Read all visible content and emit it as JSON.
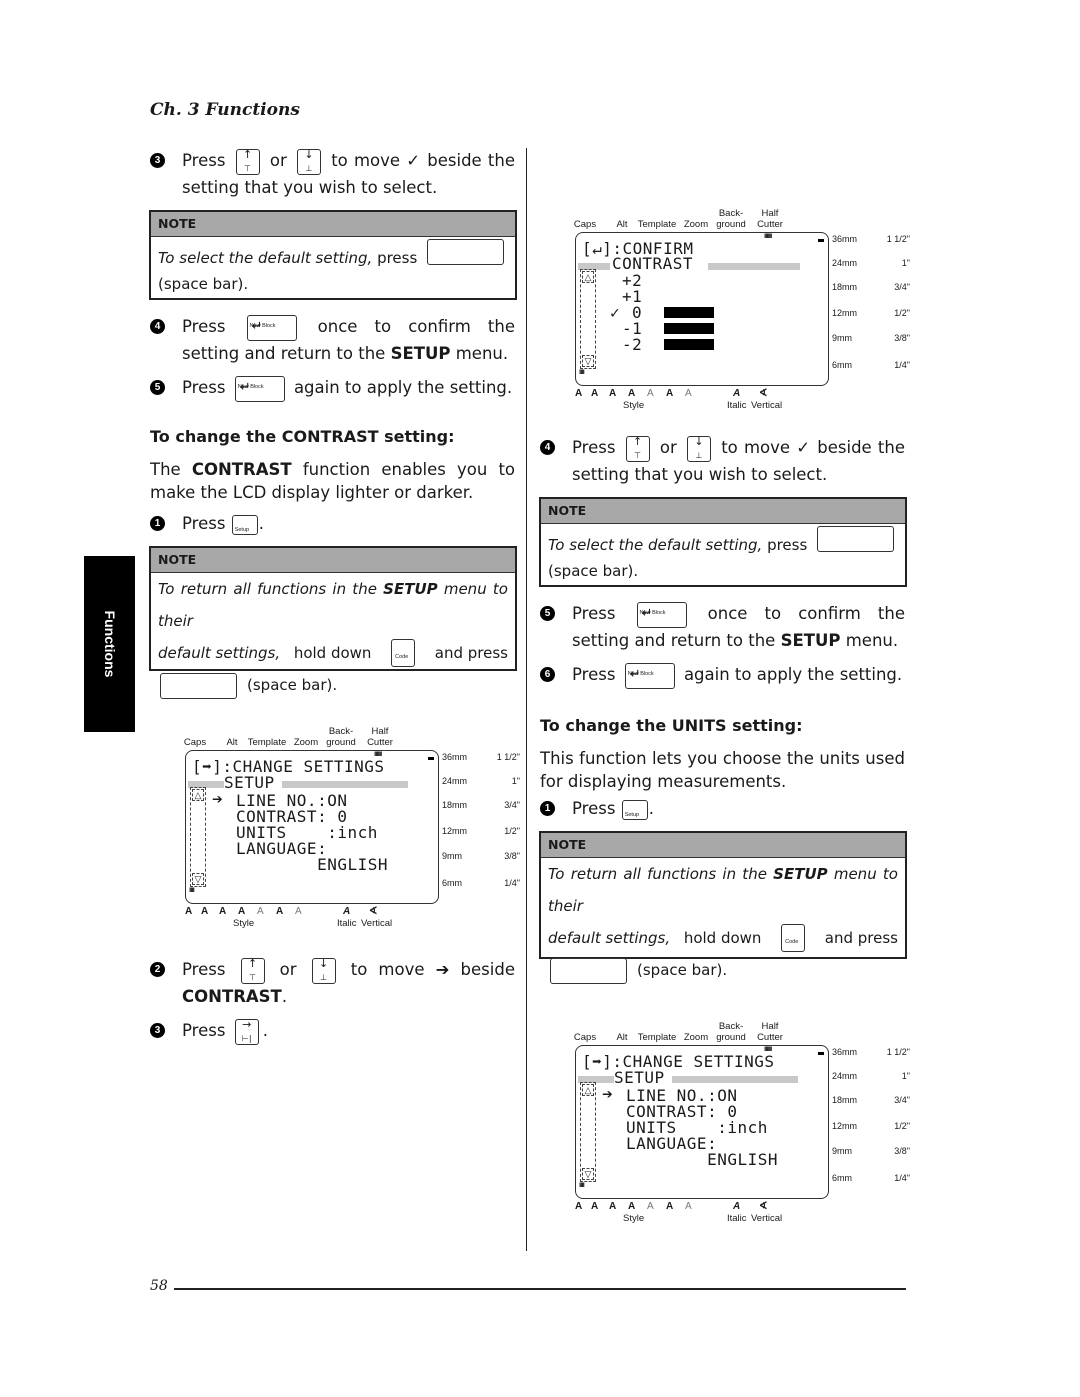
{
  "chapter_title": "Ch. 3 Functions",
  "side_tab": "Functions",
  "page_number": "58",
  "keys": {
    "up_glyph": "↑",
    "down_glyph": "↓",
    "up_sub": "⊤",
    "down_sub": "⊥",
    "right_glyph": "→",
    "right_sub": "⊢|",
    "new_block_glyph": "↵",
    "new_block_label": "New Block",
    "setup_label": "Setup",
    "code_label": "Code"
  },
  "left": {
    "step3": {
      "num": "3",
      "pre": "Press",
      "or": "or",
      "post": "to move ✓ beside the setting that you wish to select."
    },
    "note1": {
      "header": "NOTE",
      "italic": "To select the default setting,",
      "press": "press",
      "tail": "(space bar)."
    },
    "step4": {
      "num": "4",
      "pre": "Press",
      "post": "once to confirm the setting and return to the",
      "kw": "SETUP",
      "end": "menu."
    },
    "step5": {
      "num": "5",
      "pre": "Press",
      "post": "again to apply the setting."
    },
    "contrast_heading": "To change the CONTRAST setting:",
    "contrast_para": {
      "pre": "The",
      "kw": "CONTRAST",
      "post": "function enables you to make the LCD display lighter or darker."
    },
    "c_step1": {
      "num": "1",
      "pre": "Press",
      "end": "."
    },
    "note2": {
      "header": "NOTE",
      "i1": "To return all functions in the",
      "kw": "SETUP",
      "i2": "menu to their",
      "i3": "default settings,",
      "hold": "hold down",
      "and": "and press",
      "tail": "(space bar)."
    },
    "c_step2": {
      "num": "2",
      "pre": "Press",
      "or": "or",
      "post": "to move ➔ beside",
      "kw": "CONTRAST",
      "end": "."
    },
    "c_step3": {
      "num": "3",
      "pre": "Press",
      "end": "."
    }
  },
  "right": {
    "step4": {
      "num": "4",
      "pre": "Press",
      "or": "or",
      "post": "to move ✓ beside the setting that you wish to select."
    },
    "note1": {
      "header": "NOTE",
      "italic": "To select the default setting,",
      "press": "press",
      "tail": "(space bar)."
    },
    "step5": {
      "num": "5",
      "pre": "Press",
      "post": "once to confirm the setting and return to the",
      "kw": "SETUP",
      "end": "menu."
    },
    "step6": {
      "num": "6",
      "pre": "Press",
      "post": "again to apply the setting."
    },
    "units_heading": "To change the UNITS setting:",
    "units_para": "This function lets you choose the units used for displaying measurements.",
    "u_step1": {
      "num": "1",
      "pre": "Press",
      "end": "."
    },
    "note2": {
      "header": "NOTE",
      "i1": "To return all functions in the",
      "kw": "SETUP",
      "i2": "menu to their",
      "i3": "default settings,",
      "hold": "hold down",
      "and": "and press",
      "tail": "(space bar)."
    }
  },
  "lcd_common": {
    "top_labels": [
      "Caps",
      "Alt",
      "Template",
      "Zoom",
      "Back-\nground",
      "Half\nCutter"
    ],
    "tape_sizes": [
      {
        "mm": "36mm",
        "in": "1 1/2\""
      },
      {
        "mm": "24mm",
        "in": "1\""
      },
      {
        "mm": "18mm",
        "in": "3/4\""
      },
      {
        "mm": "12mm",
        "in": "1/2\""
      },
      {
        "mm": "9mm",
        "in": "3/8\""
      },
      {
        "mm": "6mm",
        "in": "1/4\""
      }
    ],
    "style_glyphs": [
      "A",
      "A",
      "A",
      "A",
      "A",
      "A",
      "A"
    ],
    "italic_glyph": "A",
    "vertical_glyph": "∢",
    "style_label": "Style",
    "italic_label": "Italic",
    "vertical_label": "Vertical"
  },
  "lcd_setup": {
    "line1": "[➡]:CHANGE SETTINGS",
    "line2": "SETUP",
    "cursor": "➔",
    "items": [
      "LINE NO.:ON",
      "CONTRAST: 0",
      "UNITS    :inch",
      "LANGUAGE:",
      "        ENGLISH"
    ]
  },
  "lcd_contrast": {
    "line1": "[↵]:CONFIRM",
    "line2": "CONTRAST",
    "options": [
      "+2",
      "+1",
      "0",
      "-1",
      "-2"
    ],
    "selected": "0",
    "check": "✓"
  }
}
